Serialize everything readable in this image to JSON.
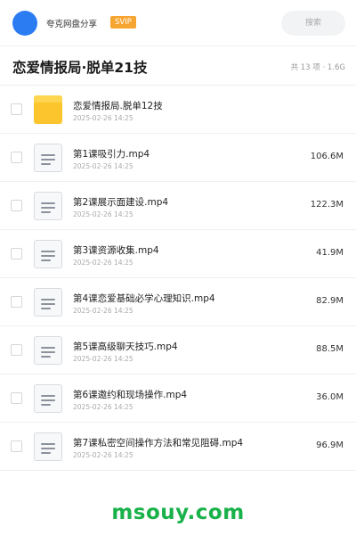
{
  "top_bar": {
    "owner_name": "夸克网盘分享",
    "badge": "SVIP",
    "search_placeholder": "搜索"
  },
  "share": {
    "title": "恋爱情报局·脱单21技",
    "meta": "共 13 项 · 1.6G"
  },
  "files": [
    {
      "name": "恋爱情报局.脱单12技",
      "date": "2025-02-26 14:25",
      "size": "",
      "type": "folder"
    },
    {
      "name": "第1课吸引力.mp4",
      "date": "2025-02-26 14:25",
      "size": "106.6M",
      "type": "file"
    },
    {
      "name": "第2课展示面建设.mp4",
      "date": "2025-02-26 14:25",
      "size": "122.3M",
      "type": "file"
    },
    {
      "name": "第3课资源收集.mp4",
      "date": "2025-02-26 14:25",
      "size": "41.9M",
      "type": "file"
    },
    {
      "name": "第4课恋爱基础必学心理知识.mp4",
      "date": "2025-02-26 14:25",
      "size": "82.9M",
      "type": "file"
    },
    {
      "name": "第5课高级聊天技巧.mp4",
      "date": "2025-02-26 14:25",
      "size": "88.5M",
      "type": "file"
    },
    {
      "name": "第6课邀约和现场操作.mp4",
      "date": "2025-02-26 14:25",
      "size": "36.0M",
      "type": "file"
    },
    {
      "name": "第7课私密空间操作方法和常见阻碍.mp4",
      "date": "2025-02-26 14:25",
      "size": "96.9M",
      "type": "file"
    }
  ],
  "watermark": "msouy.com",
  "colors": {
    "avatar": "#2b7bf3",
    "svip_badge": "#f7a531",
    "folder": "#fcc42d",
    "watermark": "#19b14a"
  }
}
